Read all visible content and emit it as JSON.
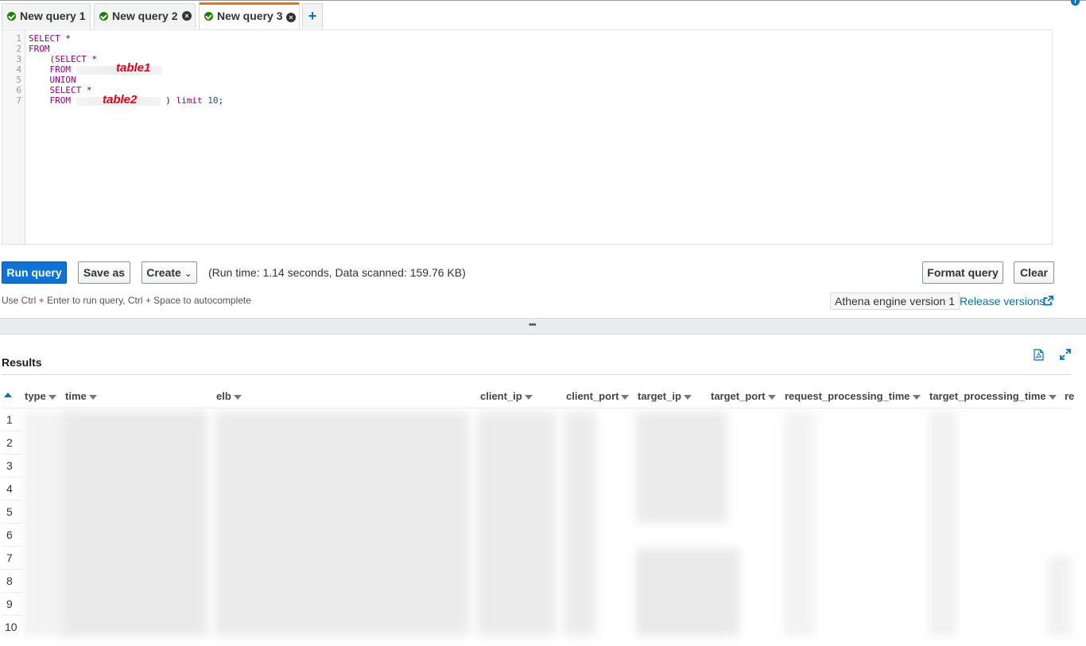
{
  "tabs": [
    {
      "label": "New query 1",
      "closable": false,
      "active": false
    },
    {
      "label": "New query 2",
      "closable": true,
      "active": false
    },
    {
      "label": "New query 3",
      "closable": true,
      "active": true
    }
  ],
  "tab_add_label": "+",
  "editor": {
    "line_numbers": [
      "1",
      "2",
      "3",
      "4",
      "5",
      "6",
      "7"
    ],
    "lines": {
      "l1_kw": "SELECT",
      "l1_rest": " *",
      "l2_kw": "FROM",
      "l3_kw": "    (SELECT",
      "l3_rest": " *",
      "l4_kw": "    FROM",
      "l5_kw": "    UNION",
      "l6_kw": "    SELECT",
      "l6_rest": " *",
      "l7_kw": "    FROM",
      "l7_rest": ") ",
      "l7_kw2": "limit",
      "l7_num": "10",
      "l7_end": ";"
    },
    "table_annotations": [
      "table1",
      "table2"
    ]
  },
  "toolbar": {
    "run_label": "Run query",
    "save_label": "Save as",
    "create_label": "Create",
    "create_caret": "⌄",
    "runtime_text": "(Run time: 1.14 seconds, Data scanned: 159.76 KB)",
    "format_label": "Format query",
    "clear_label": "Clear",
    "hint_text": "Use Ctrl + Enter to run query, Ctrl + Space to autocomplete",
    "engine_label": "Athena engine version 1",
    "release_label": "Release versions"
  },
  "splitter_label": "•••",
  "results": {
    "title": "Results",
    "columns": [
      "type",
      "time",
      "elb",
      "client_ip",
      "client_port",
      "target_ip",
      "target_port",
      "request_processing_time",
      "target_processing_time",
      "re"
    ],
    "row_numbers": [
      "1",
      "2",
      "3",
      "4",
      "5",
      "6",
      "7",
      "8",
      "9",
      "10"
    ]
  },
  "colors": {
    "accent": "#0f72d6",
    "active_tab": "#ec7211",
    "success": "#1d8102",
    "link": "#0073bb"
  },
  "icons": [
    "info-icon",
    "check-circle-icon",
    "close-icon",
    "plus-icon",
    "chevron-down-icon",
    "external-link-icon",
    "pdf-download-icon",
    "expand-icon",
    "sort-ascending-icon",
    "sort-caret-icon"
  ]
}
